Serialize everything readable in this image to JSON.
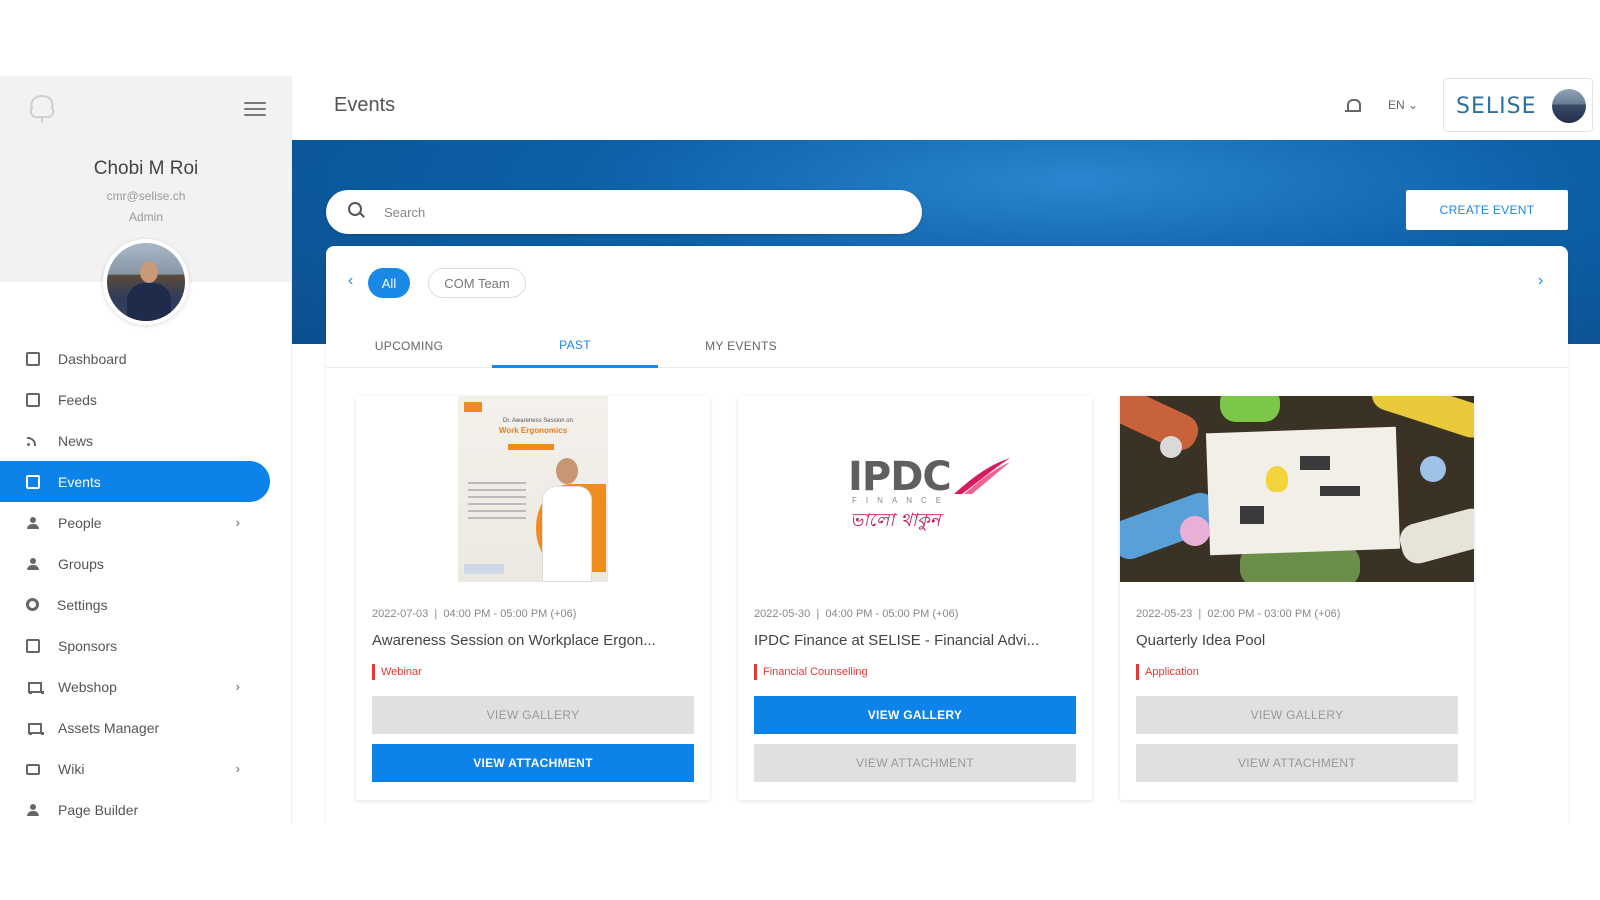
{
  "sidebar": {
    "user": {
      "name": "Chobi M Roi",
      "email": "cmr@selise.ch",
      "role": "Admin"
    },
    "items": [
      {
        "label": "Dashboard",
        "icon": "dashboard-icon",
        "has_submenu": false,
        "active": false
      },
      {
        "label": "Feeds",
        "icon": "feeds-icon",
        "has_submenu": false,
        "active": false
      },
      {
        "label": "News",
        "icon": "rss-icon",
        "has_submenu": false,
        "active": false
      },
      {
        "label": "Events",
        "icon": "calendar-icon",
        "has_submenu": false,
        "active": true
      },
      {
        "label": "People",
        "icon": "people-icon",
        "has_submenu": true,
        "active": false
      },
      {
        "label": "Groups",
        "icon": "groups-icon",
        "has_submenu": false,
        "active": false
      },
      {
        "label": "Settings",
        "icon": "gear-icon",
        "has_submenu": false,
        "active": false
      },
      {
        "label": "Sponsors",
        "icon": "sponsors-icon",
        "has_submenu": false,
        "active": false
      },
      {
        "label": "Webshop",
        "icon": "cart-icon",
        "has_submenu": true,
        "active": false
      },
      {
        "label": "Assets Manager",
        "icon": "cart-icon",
        "has_submenu": false,
        "active": false
      },
      {
        "label": "Wiki",
        "icon": "camera-icon",
        "has_submenu": true,
        "active": false
      },
      {
        "label": "Page Builder",
        "icon": "builder-icon",
        "has_submenu": false,
        "active": false
      }
    ]
  },
  "header": {
    "title": "Events",
    "language": "EN",
    "brand": "SELISE"
  },
  "search": {
    "placeholder": "Search",
    "value": ""
  },
  "create_button": "CREATE EVENT",
  "filters": {
    "chips": [
      "All",
      "COM Team"
    ],
    "selected": "All"
  },
  "tabs": {
    "items": [
      "UPCOMING",
      "PAST",
      "MY EVENTS"
    ],
    "active": "PAST"
  },
  "events": [
    {
      "date": "2022-07-03",
      "time": "04:00 PM - 05:00 PM (+06)",
      "title": "Awareness Session on Workplace Ergon...",
      "category": "Webinar",
      "buttons": {
        "gallery": "VIEW GALLERY",
        "attachment": "VIEW ATTACHMENT"
      },
      "primary": "attachment",
      "poster": {
        "header_small": "Dr. Awareness Session on",
        "header_title": "Work Ergonomics",
        "speaker_label": "Dr. Shahin Ahmed"
      }
    },
    {
      "date": "2022-05-30",
      "time": "04:00 PM - 05:00 PM (+06)",
      "title": "IPDC Finance at SELISE - Financial Advi...",
      "category": "Financial Counselling",
      "buttons": {
        "gallery": "VIEW GALLERY",
        "attachment": "VIEW ATTACHMENT"
      },
      "primary": "gallery",
      "logo": {
        "name": "IPDC",
        "sub": "FINANCE",
        "tagline": "ভালো থাকুন"
      }
    },
    {
      "date": "2022-05-23",
      "time": "02:00 PM - 03:00 PM (+06)",
      "title": "Quarterly Idea Pool",
      "category": "Application",
      "buttons": {
        "gallery": "VIEW GALLERY",
        "attachment": "VIEW ATTACHMENT"
      },
      "primary": "none"
    }
  ],
  "colors": {
    "accent": "#0d82e8",
    "hero": "#0b4f8e",
    "category": "#e53935",
    "disabled_button": "#e0e0e0"
  }
}
